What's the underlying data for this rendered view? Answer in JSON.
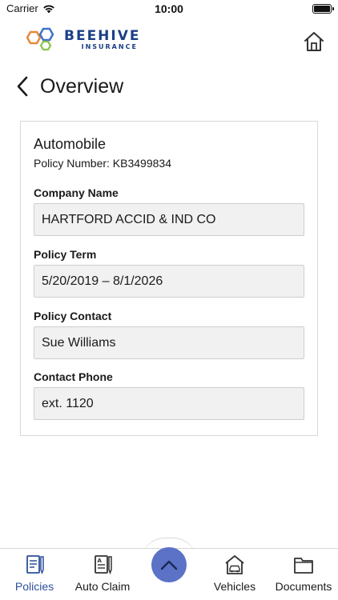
{
  "status_bar": {
    "carrier": "Carrier",
    "time": "10:00"
  },
  "header": {
    "logo_name": "BEEHIVE",
    "logo_sub": "INSURANCE",
    "home_icon": "home-icon"
  },
  "page": {
    "title": "Overview",
    "back_icon": "chevron-left-icon"
  },
  "policy": {
    "type": "Automobile",
    "number_text": "Policy Number: KB3499834",
    "fields": [
      {
        "label": "Company Name",
        "value": "HARTFORD ACCID & IND CO"
      },
      {
        "label": "Policy Term",
        "value": "5/20/2019 – 8/1/2026"
      },
      {
        "label": "Policy Contact",
        "value": "Sue Williams"
      },
      {
        "label": "Contact Phone",
        "value": "ext. 1120"
      }
    ]
  },
  "tab_bar": {
    "tabs": [
      {
        "label": "Policies",
        "icon": "policies-icon",
        "active": true
      },
      {
        "label": "Auto Claim",
        "icon": "auto-claim-icon",
        "active": false
      },
      {
        "label": "Vehicles",
        "icon": "vehicles-icon",
        "active": false
      },
      {
        "label": "Documents",
        "icon": "documents-icon",
        "active": false
      }
    ],
    "center_icon": "chevron-up-icon"
  },
  "colors": {
    "brand_blue": "#1c3f86",
    "active_tab": "#2d4f9c",
    "fab": "#5b72c6",
    "logo_orange": "#e8893a",
    "logo_blue": "#3f73c9",
    "logo_green": "#8cc34a"
  }
}
